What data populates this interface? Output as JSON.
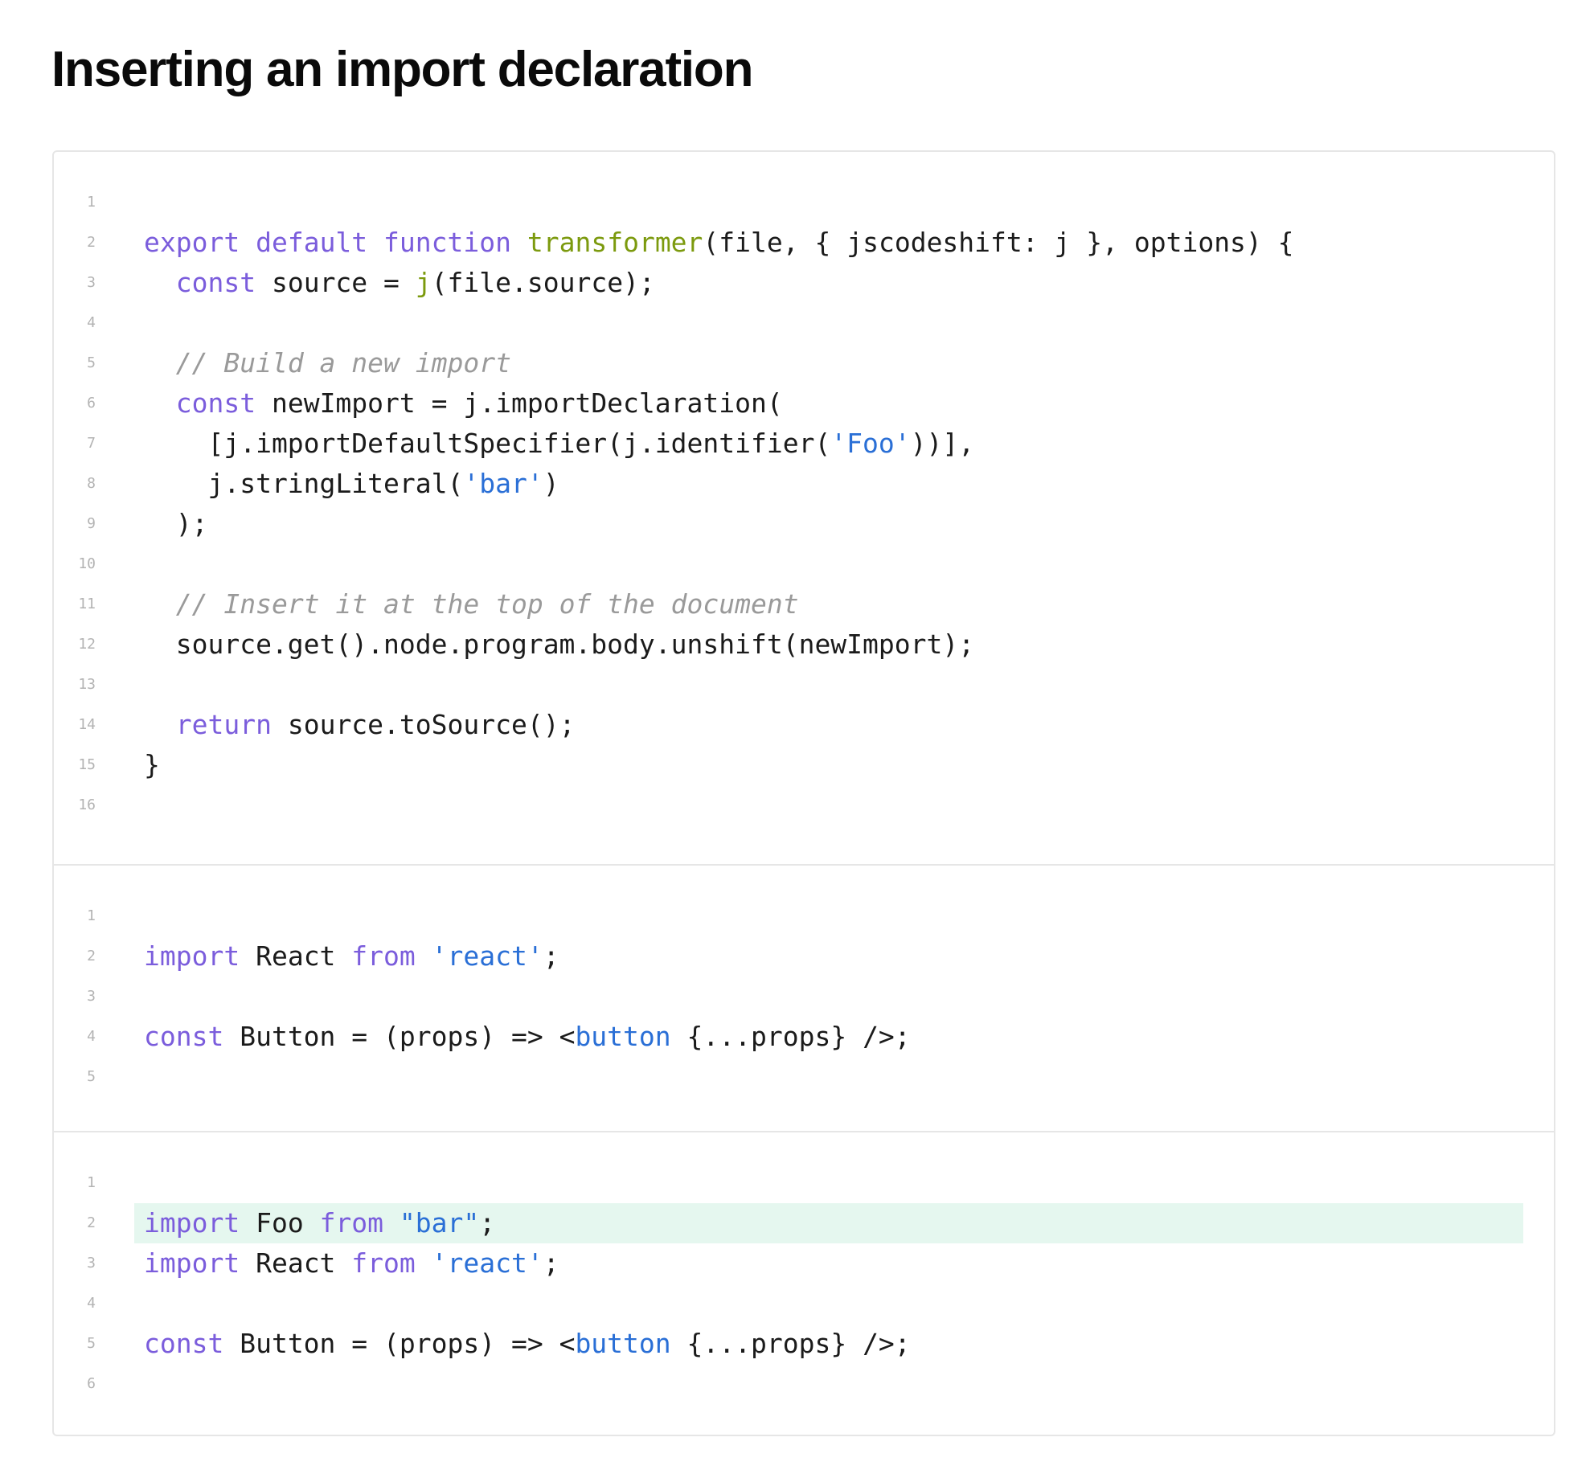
{
  "page": {
    "title": "Inserting an import declaration"
  },
  "colors": {
    "keyword": "#7b5ddc",
    "function": "#7c9a0e",
    "string": "#2a6fd6",
    "comment": "#9a9a9a",
    "plain": "#1b1b1b",
    "highlight_background": "#e5f7ef",
    "border": "#e6e6e6",
    "line_number": "#b3b3b3"
  },
  "code_panels": [
    {
      "name": "transformer-code",
      "lines": [
        {
          "number": "1",
          "tokens": []
        },
        {
          "number": "2",
          "tokens": [
            {
              "text": "export",
              "type": "keyword"
            },
            {
              "text": " ",
              "type": "plain"
            },
            {
              "text": "default",
              "type": "keyword"
            },
            {
              "text": " ",
              "type": "plain"
            },
            {
              "text": "function",
              "type": "keyword"
            },
            {
              "text": " ",
              "type": "plain"
            },
            {
              "text": "transformer",
              "type": "function"
            },
            {
              "text": "(file, { jscodeshift: j }, options) {",
              "type": "plain"
            }
          ]
        },
        {
          "number": "3",
          "tokens": [
            {
              "text": "  ",
              "type": "plain"
            },
            {
              "text": "const",
              "type": "keyword"
            },
            {
              "text": " source = ",
              "type": "plain"
            },
            {
              "text": "j",
              "type": "function"
            },
            {
              "text": "(file.source);",
              "type": "plain"
            }
          ]
        },
        {
          "number": "4",
          "tokens": []
        },
        {
          "number": "5",
          "tokens": [
            {
              "text": "  ",
              "type": "plain"
            },
            {
              "text": "// Build a new import",
              "type": "comment"
            }
          ]
        },
        {
          "number": "6",
          "tokens": [
            {
              "text": "  ",
              "type": "plain"
            },
            {
              "text": "const",
              "type": "keyword"
            },
            {
              "text": " newImport = j.importDeclaration(",
              "type": "plain"
            }
          ]
        },
        {
          "number": "7",
          "tokens": [
            {
              "text": "    [j.importDefaultSpecifier(j.identifier(",
              "type": "plain"
            },
            {
              "text": "'Foo'",
              "type": "string"
            },
            {
              "text": "))],",
              "type": "plain"
            }
          ]
        },
        {
          "number": "8",
          "tokens": [
            {
              "text": "    j.stringLiteral(",
              "type": "plain"
            },
            {
              "text": "'bar'",
              "type": "string"
            },
            {
              "text": ")",
              "type": "plain"
            }
          ]
        },
        {
          "number": "9",
          "tokens": [
            {
              "text": "  );",
              "type": "plain"
            }
          ]
        },
        {
          "number": "10",
          "tokens": []
        },
        {
          "number": "11",
          "tokens": [
            {
              "text": "  ",
              "type": "plain"
            },
            {
              "text": "// Insert it at the top of the document",
              "type": "comment"
            }
          ]
        },
        {
          "number": "12",
          "tokens": [
            {
              "text": "  source.get().node.program.body.unshift(newImport);",
              "type": "plain"
            }
          ]
        },
        {
          "number": "13",
          "tokens": []
        },
        {
          "number": "14",
          "tokens": [
            {
              "text": "  ",
              "type": "plain"
            },
            {
              "text": "return",
              "type": "keyword"
            },
            {
              "text": " source.toSource();",
              "type": "plain"
            }
          ]
        },
        {
          "number": "15",
          "tokens": [
            {
              "text": "}",
              "type": "plain"
            }
          ]
        },
        {
          "number": "16",
          "tokens": []
        }
      ]
    },
    {
      "name": "input-code",
      "lines": [
        {
          "number": "1",
          "tokens": []
        },
        {
          "number": "2",
          "tokens": [
            {
              "text": "import",
              "type": "keyword"
            },
            {
              "text": " React ",
              "type": "plain"
            },
            {
              "text": "from",
              "type": "keyword"
            },
            {
              "text": " ",
              "type": "plain"
            },
            {
              "text": "'react'",
              "type": "string"
            },
            {
              "text": ";",
              "type": "plain"
            }
          ]
        },
        {
          "number": "3",
          "tokens": []
        },
        {
          "number": "4",
          "tokens": [
            {
              "text": "const",
              "type": "keyword"
            },
            {
              "text": " Button = (props) => <",
              "type": "plain"
            },
            {
              "text": "button",
              "type": "tag"
            },
            {
              "text": " {...props} />;",
              "type": "plain"
            }
          ]
        },
        {
          "number": "5",
          "tokens": []
        }
      ]
    },
    {
      "name": "output-code",
      "lines": [
        {
          "number": "1",
          "tokens": []
        },
        {
          "number": "2",
          "highlighted": true,
          "tokens": [
            {
              "text": "import",
              "type": "keyword"
            },
            {
              "text": " Foo ",
              "type": "plain"
            },
            {
              "text": "from",
              "type": "keyword"
            },
            {
              "text": " ",
              "type": "plain"
            },
            {
              "text": "\"bar\"",
              "type": "string"
            },
            {
              "text": ";",
              "type": "plain"
            }
          ]
        },
        {
          "number": "3",
          "tokens": [
            {
              "text": "import",
              "type": "keyword"
            },
            {
              "text": " React ",
              "type": "plain"
            },
            {
              "text": "from",
              "type": "keyword"
            },
            {
              "text": " ",
              "type": "plain"
            },
            {
              "text": "'react'",
              "type": "string"
            },
            {
              "text": ";",
              "type": "plain"
            }
          ]
        },
        {
          "number": "4",
          "tokens": []
        },
        {
          "number": "5",
          "tokens": [
            {
              "text": "const",
              "type": "keyword"
            },
            {
              "text": " Button = (props) => <",
              "type": "plain"
            },
            {
              "text": "button",
              "type": "tag"
            },
            {
              "text": " {...props} />;",
              "type": "plain"
            }
          ]
        },
        {
          "number": "6",
          "tokens": []
        }
      ]
    }
  ]
}
